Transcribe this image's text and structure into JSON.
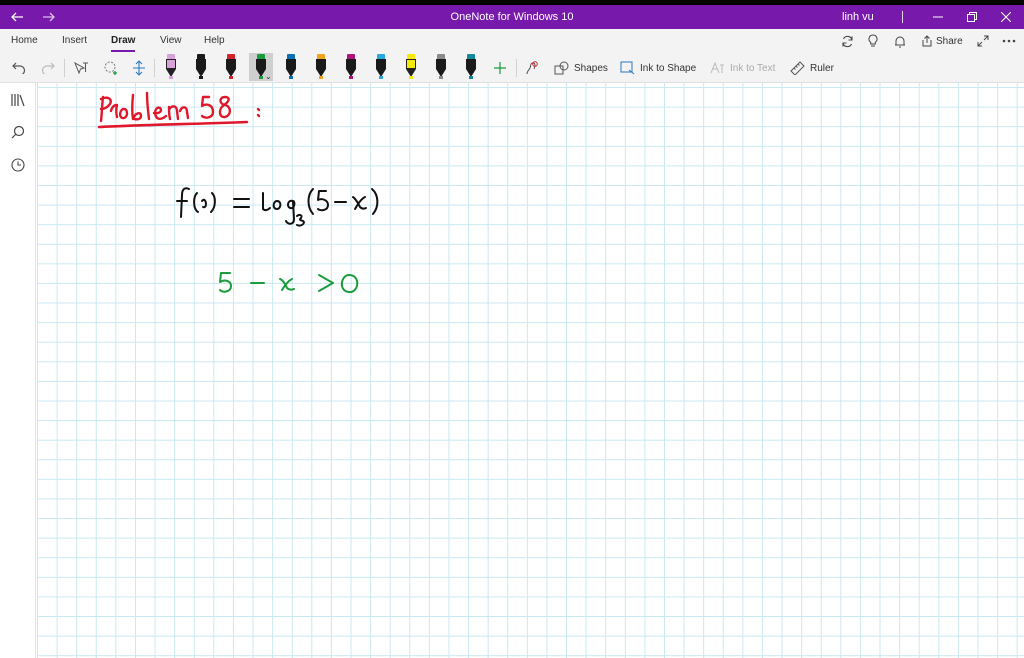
{
  "titlebar": {
    "title": "OneNote for Windows 10",
    "user": "linh vu",
    "back_icon": "back-arrow-icon",
    "forward_icon": "forward-arrow-icon",
    "minimize_icon": "minimize-icon",
    "maximize_icon": "restore-icon",
    "close_icon": "close-icon",
    "color": "#7719aa"
  },
  "tabs": {
    "items": [
      {
        "label": "Home"
      },
      {
        "label": "Insert"
      },
      {
        "label": "Draw",
        "active": true
      },
      {
        "label": "View"
      },
      {
        "label": "Help"
      }
    ],
    "share_label": "Share",
    "icons": [
      "sync-icon",
      "lightbulb-icon",
      "bell-icon",
      "share-icon",
      "expand-icon",
      "more-icon"
    ]
  },
  "toolbar": {
    "undo_icon": "undo-icon",
    "redo_icon": "redo-icon",
    "pens": [
      {
        "name": "highlighter-pink",
        "cap": "#d6a2d8"
      },
      {
        "name": "pen-black",
        "cap": "#1a1a1a"
      },
      {
        "name": "pen-red",
        "cap": "#d4232a"
      },
      {
        "name": "pen-green",
        "cap": "#1a9c3c",
        "selected": true
      },
      {
        "name": "pen-blue",
        "cap": "#0b6fb8"
      },
      {
        "name": "pen-orange",
        "cap": "#f0a21a"
      },
      {
        "name": "pen-magenta",
        "cap": "#b0137d"
      },
      {
        "name": "pen-cyan",
        "cap": "#29a8df"
      },
      {
        "name": "highlighter-yellow",
        "cap": "#f5e90b"
      },
      {
        "name": "pen-gray",
        "cap": "#8a8a8a"
      },
      {
        "name": "pen-teal",
        "cap": "#138a9c"
      }
    ],
    "shapes_label": "Shapes",
    "ink_to_shape_label": "Ink to Shape",
    "ink_to_text_label": "Ink to Text",
    "ruler_label": "Ruler"
  },
  "ink": {
    "heading": "Problem 58 :",
    "equation": "f(x) = log3(5 - x)",
    "condition": "5 - x > 0",
    "heading_color": "#e0182c",
    "equation_color": "#111111",
    "condition_color": "#1a9c3c"
  }
}
